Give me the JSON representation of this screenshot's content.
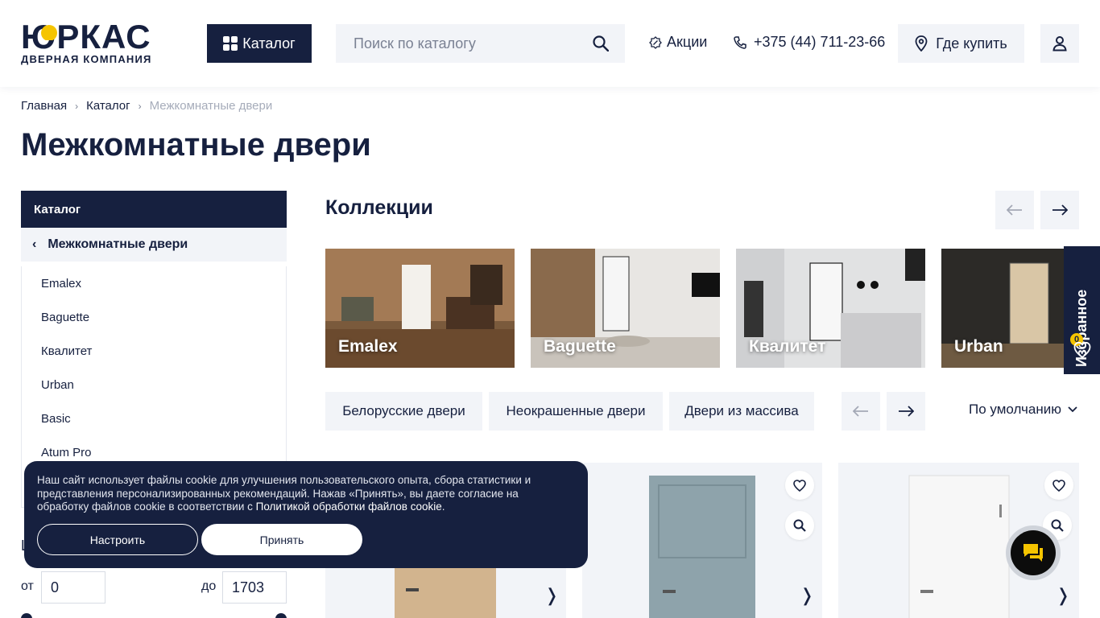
{
  "header": {
    "logo_main_a": "Ю",
    "logo_main_b": "РКАС",
    "logo_sub": "ДВЕРНАЯ КОМПАНИЯ",
    "catalog_label": "Каталог",
    "search_placeholder": "Поиск по каталогу",
    "promo_label": "Акции",
    "phone": "+375 (44) 711-23-66",
    "where_label": "Где купить"
  },
  "breadcrumb": [
    "Главная",
    "Каталог",
    "Межкомнатные двери"
  ],
  "page_title": "Межкомнатные двери",
  "sidebar": {
    "head": "Каталог",
    "sub": "Межкомнатные двери",
    "items": [
      "Emalex",
      "Baguette",
      "Квалитет",
      "Urban",
      "Basic",
      "Atum Pro"
    ],
    "peek": "Ц"
  },
  "price": {
    "from_label": "от",
    "from_value": "0",
    "to_label": "до",
    "to_value": "1703"
  },
  "collections": {
    "title": "Коллекции",
    "cards": [
      "Emalex",
      "Baguette",
      "Квалитет",
      "Urban"
    ]
  },
  "tags": [
    "Белорусские двери",
    "Неокрашенные двери",
    "Двери из массива"
  ],
  "sort_label": "По умолчанию",
  "favorites": {
    "label": "Избранное",
    "count": "0"
  },
  "cookie": {
    "text": "Наш сайт использует файлы cookie для улучшения пользовательского опыта, сбора статистики и представления персонализированных рекомендаций. Нажав «Принять», вы даете согласие на обработку файлов cookie в соответствии с ",
    "link": "Политикой обработки файлов cookie",
    "tail": ".",
    "setup_label": "Настроить",
    "accept_label": "Принять"
  },
  "colors": {
    "brand_dark": "#16203f",
    "accent_yellow": "#f5c400",
    "light_bg": "#f2f4f8"
  }
}
